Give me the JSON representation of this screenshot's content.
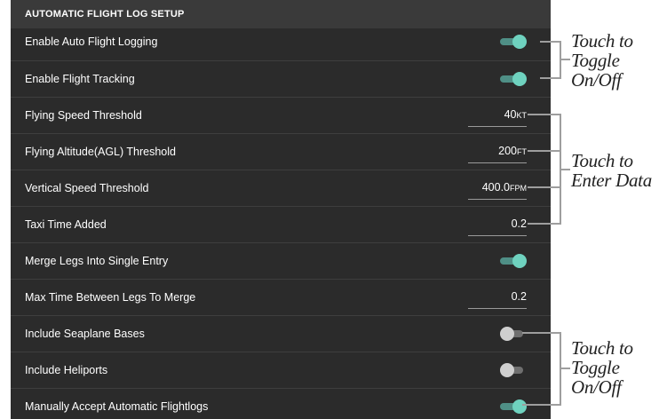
{
  "panel": {
    "title": "AUTOMATIC FLIGHT LOG SETUP",
    "rows": [
      {
        "label": "Enable Auto Flight Logging",
        "type": "toggle",
        "on": true
      },
      {
        "label": "Enable Flight Tracking",
        "type": "toggle",
        "on": true
      },
      {
        "label": "Flying Speed Threshold",
        "type": "field",
        "value": "40",
        "unit": "KT"
      },
      {
        "label": "Flying Altitude(AGL) Threshold",
        "type": "field",
        "value": "200",
        "unit": "FT"
      },
      {
        "label": "Vertical Speed Threshold",
        "type": "field",
        "value": "400.0",
        "unit": "FPM"
      },
      {
        "label": "Taxi Time Added",
        "type": "field",
        "value": "0.2",
        "unit": ""
      },
      {
        "label": "Merge Legs Into Single Entry",
        "type": "toggle",
        "on": true
      },
      {
        "label": "Max Time Between Legs To Merge",
        "type": "field",
        "value": "0.2",
        "unit": ""
      },
      {
        "label": "Include Seaplane Bases",
        "type": "toggle",
        "on": false
      },
      {
        "label": "Include Heliports",
        "type": "toggle",
        "on": false
      },
      {
        "label": "Manually Accept Automatic Flightlogs",
        "type": "toggle",
        "on": true
      }
    ]
  },
  "callouts": {
    "toggle_top": [
      "Touch to",
      "Toggle",
      "On/Off"
    ],
    "enter_data": [
      "Touch to",
      "Enter Data"
    ],
    "toggle_bottom": [
      "Touch to",
      "Toggle",
      "On/Off"
    ]
  },
  "colors": {
    "panel_bg": "#2b2b2b",
    "header_bg": "#3a3a3a",
    "toggle_on_thumb": "#6fd2bf",
    "toggle_on_track": "#4f8f86",
    "toggle_off_thumb": "#cfcfcf",
    "toggle_off_track": "#6f6f6f"
  }
}
